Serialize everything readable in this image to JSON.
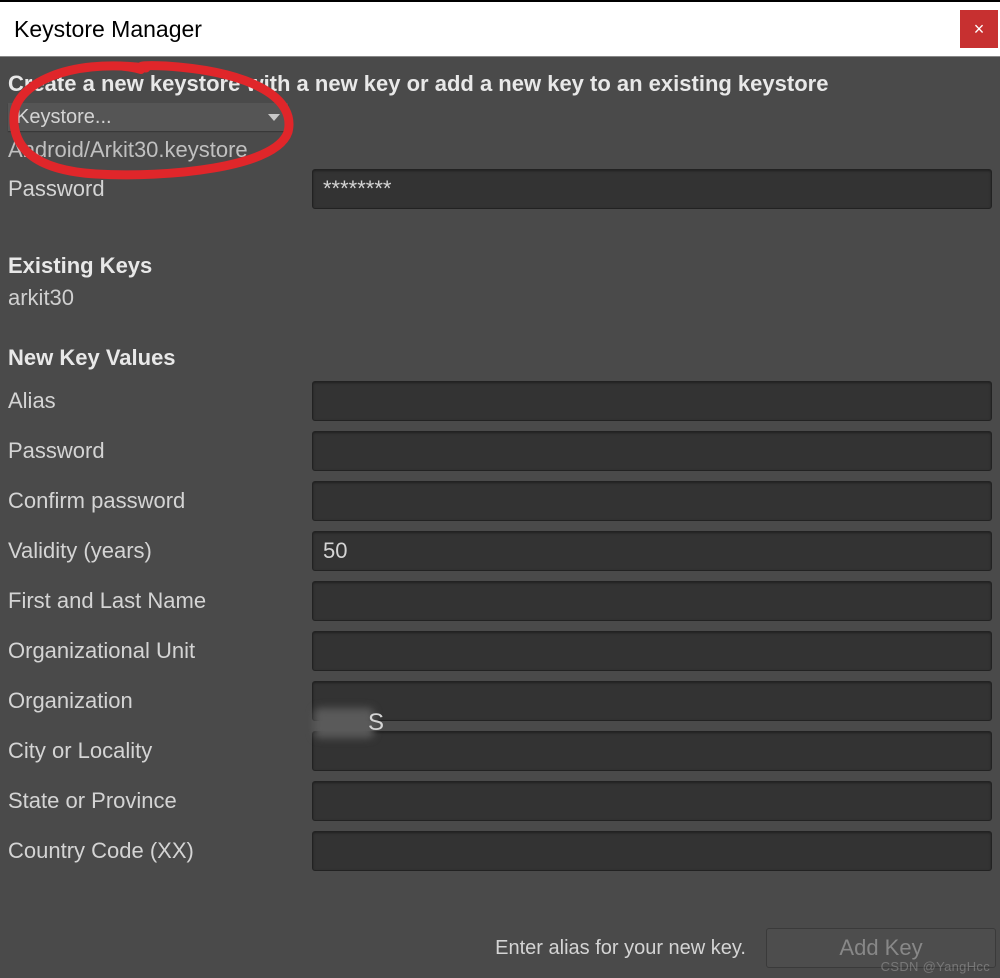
{
  "titlebar": {
    "title": "Keystore Manager",
    "close_label": "×"
  },
  "instruction": "Create a new keystore with a new key or add a new key to an existing keystore",
  "dropdown": {
    "label": "Keystore..."
  },
  "keystore_path": "Android/Arkit30.keystore",
  "password": {
    "label": "Password",
    "value": "********"
  },
  "existing": {
    "header": "Existing Keys",
    "items": [
      "arkit30"
    ]
  },
  "newkey": {
    "header": "New Key Values",
    "alias_label": "Alias",
    "alias_value": "",
    "password_label": "Password",
    "password_value": "",
    "confirm_label": "Confirm password",
    "confirm_value": "",
    "validity_label": "Validity (years)",
    "validity_value": "50",
    "name_label": "First and Last Name",
    "name_value": "",
    "ou_label": "Organizational Unit",
    "ou_value": "",
    "org_label": "Organization",
    "org_value": "",
    "city_label": "City or Locality",
    "city_value": "",
    "state_label": "State or Province",
    "state_value": "",
    "country_label": "Country Code (XX)",
    "country_value": ""
  },
  "footer": {
    "hint": "Enter alias for your new key.",
    "button": "Add Key"
  },
  "watermark": "CSDN @YangHcc"
}
